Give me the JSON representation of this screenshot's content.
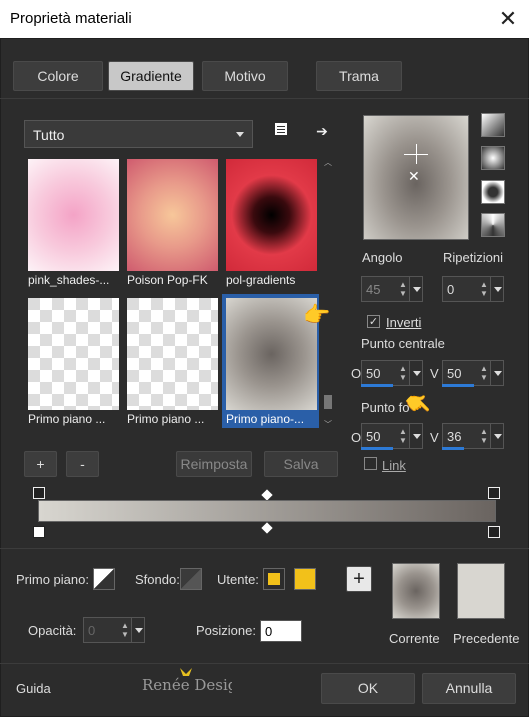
{
  "window": {
    "title": "Proprietà materiali",
    "close": "✕"
  },
  "tabs": [
    {
      "label": "Colore",
      "selected": false
    },
    {
      "label": "Gradiente",
      "selected": true
    },
    {
      "label": "Motivo",
      "selected": false
    },
    {
      "label": "Trama",
      "selected": false
    }
  ],
  "library": {
    "category": "Tutto",
    "items": [
      {
        "label": "pink_shades-..."
      },
      {
        "label": "Poison Pop-FK"
      },
      {
        "label": "pol-gradients"
      },
      {
        "label": "Primo piano ..."
      },
      {
        "label": "Primo piano ..."
      },
      {
        "label": "Primo piano-..."
      }
    ],
    "add": "+",
    "remove": "-",
    "reset": "Reimposta",
    "save": "Salva"
  },
  "params": {
    "angle_label": "Angolo",
    "angle_value": "45",
    "repeats_label": "Ripetizioni",
    "repeats_value": "0",
    "invert_label": "Inverti",
    "invert_checked": true,
    "center_label": "Punto centrale",
    "center_o_label": "O",
    "center_o_value": "50",
    "center_v_label": "V",
    "center_v_value": "50",
    "focus_label": "Punto fo",
    "focus_o_label": "O",
    "focus_o_value": "50",
    "focus_v_label": "V",
    "focus_v_value": "36",
    "link_label": "Link",
    "link_checked": false
  },
  "bottom": {
    "primo_label": "Primo piano:",
    "sfondo_label": "Sfondo:",
    "utente_label": "Utente:",
    "user_color": "#f2c11a",
    "opacity_label": "Opacità:",
    "opacity_value": "0",
    "position_label": "Posizione:",
    "position_value": "0",
    "current_label": "Corrente",
    "previous_label": "Precedente",
    "plus": "+"
  },
  "footer": {
    "help": "Guida",
    "ok": "OK",
    "cancel": "Annulla"
  },
  "icons": {
    "arrow": "➔",
    "hand": "👉"
  }
}
